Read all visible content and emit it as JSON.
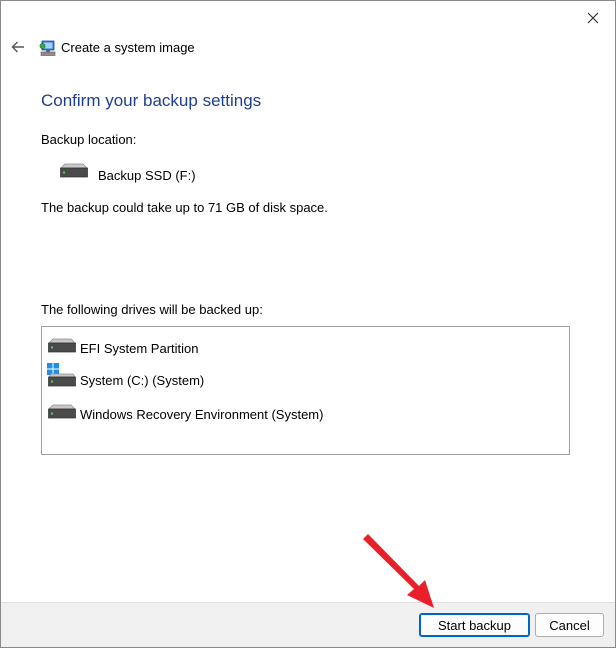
{
  "window": {
    "title": "Create a system image"
  },
  "page": {
    "heading": "Confirm your backup settings",
    "backup_location_label": "Backup location:",
    "backup_location": "Backup SSD (F:)",
    "space_text": "The backup could take up to 71 GB of disk space.",
    "drives_label": "The following drives will be backed up:",
    "drives": [
      {
        "name": "EFI System Partition",
        "icon": "drive-icon"
      },
      {
        "name": "System (C:) (System)",
        "icon": "windows-drive-icon"
      },
      {
        "name": "Windows Recovery Environment (System)",
        "icon": "drive-icon"
      }
    ]
  },
  "footer": {
    "start_label": "Start backup",
    "cancel_label": "Cancel"
  },
  "colors": {
    "heading": "#1e3f8c",
    "accent": "#0067c0",
    "annotation_arrow": "#e8202a"
  }
}
